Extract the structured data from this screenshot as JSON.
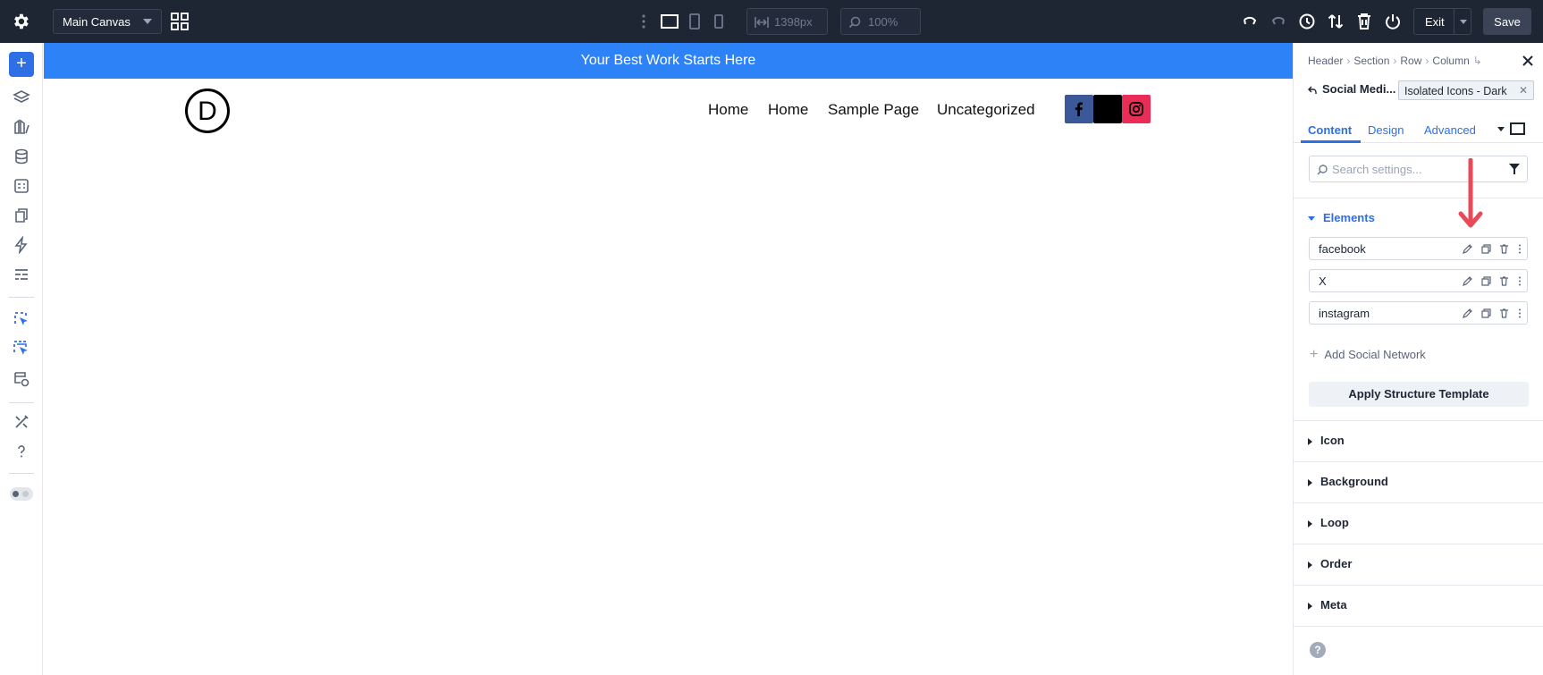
{
  "topbar": {
    "canvas_select": "Main Canvas",
    "width_value": "1398px",
    "zoom_value": "100%",
    "exit_label": "Exit",
    "save_label": "Save"
  },
  "canvas": {
    "banner_text": "Your Best Work Starts Here",
    "logo_letter": "D",
    "nav_items": [
      "Home",
      "Home",
      "Sample Page",
      "Uncategorized"
    ],
    "social_icons": [
      {
        "name": "facebook",
        "color": "#3b5998"
      },
      {
        "name": "x",
        "color": "#000000"
      },
      {
        "name": "instagram",
        "color": "#ea2c59"
      }
    ]
  },
  "panel": {
    "breadcrumbs": [
      "Header",
      "Section",
      "Row",
      "Column"
    ],
    "module_name": "Social Medi...",
    "preset": "Isolated Icons - Dark",
    "tabs": [
      "Content",
      "Design",
      "Advanced"
    ],
    "search_placeholder": "Search settings...",
    "elements_section": "Elements",
    "elements": [
      "facebook",
      "X",
      "instagram"
    ],
    "add_network": "Add Social Network",
    "structure_button": "Apply Structure Template",
    "sections": [
      "Icon",
      "Background",
      "Loop",
      "Order",
      "Meta"
    ],
    "help_glyph": "?"
  },
  "colors": {
    "topbar_bg": "#1e2533",
    "accent": "#2e6fe6",
    "banner": "#2e82f8",
    "annotation_arrow": "#e94a57"
  }
}
